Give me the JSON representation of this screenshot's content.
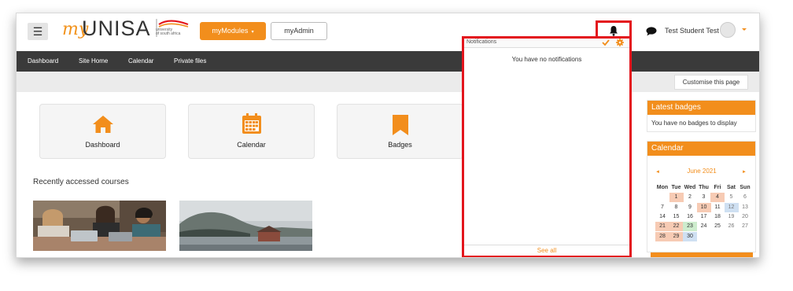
{
  "header": {
    "menu_icon": "hamburger-icon",
    "logo_my": "my",
    "logo_unisa": "UNISA",
    "logo_sub_line1": "university",
    "logo_sub_line2": "of south africa",
    "mymodules_label": "myModules",
    "myadmin_label": "myAdmin",
    "user_name": "Test Student Test 1"
  },
  "nav": {
    "items": [
      {
        "label": "Dashboard"
      },
      {
        "label": "Site Home"
      },
      {
        "label": "Calendar"
      },
      {
        "label": "Private files"
      }
    ]
  },
  "customise_label": "Customise this page",
  "tiles": [
    {
      "label": "Dashboard",
      "icon": "home-icon"
    },
    {
      "label": "Calendar",
      "icon": "calendar-icon"
    },
    {
      "label": "Badges",
      "icon": "bookmark-icon"
    }
  ],
  "recent_heading": "Recently accessed courses",
  "notifications": {
    "title": "Notifications",
    "empty_text": "You have no notifications",
    "see_all": "See all"
  },
  "badges_block": {
    "title": "Latest badges",
    "text": "You have no badges to display"
  },
  "calendar_block": {
    "title": "Calendar",
    "month": "June 2021",
    "prev_arrow": "◄",
    "next_arrow": "►",
    "weekdays": [
      "Mon",
      "Tue",
      "Wed",
      "Thu",
      "Fri",
      "Sat",
      "Sun"
    ],
    "weeks": [
      [
        "",
        "1",
        "2",
        "3",
        "4",
        "5",
        "6"
      ],
      [
        "7",
        "8",
        "9",
        "10",
        "11",
        "12",
        "13"
      ],
      [
        "14",
        "15",
        "16",
        "17",
        "18",
        "19",
        "20"
      ],
      [
        "21",
        "22",
        "23",
        "24",
        "25",
        "26",
        "27"
      ],
      [
        "28",
        "29",
        "30",
        "",
        "",
        "",
        ""
      ]
    ]
  },
  "colors": {
    "accent": "#f28e1c",
    "highlight": "#e3151d",
    "nav_bg": "#3a3a3a"
  }
}
